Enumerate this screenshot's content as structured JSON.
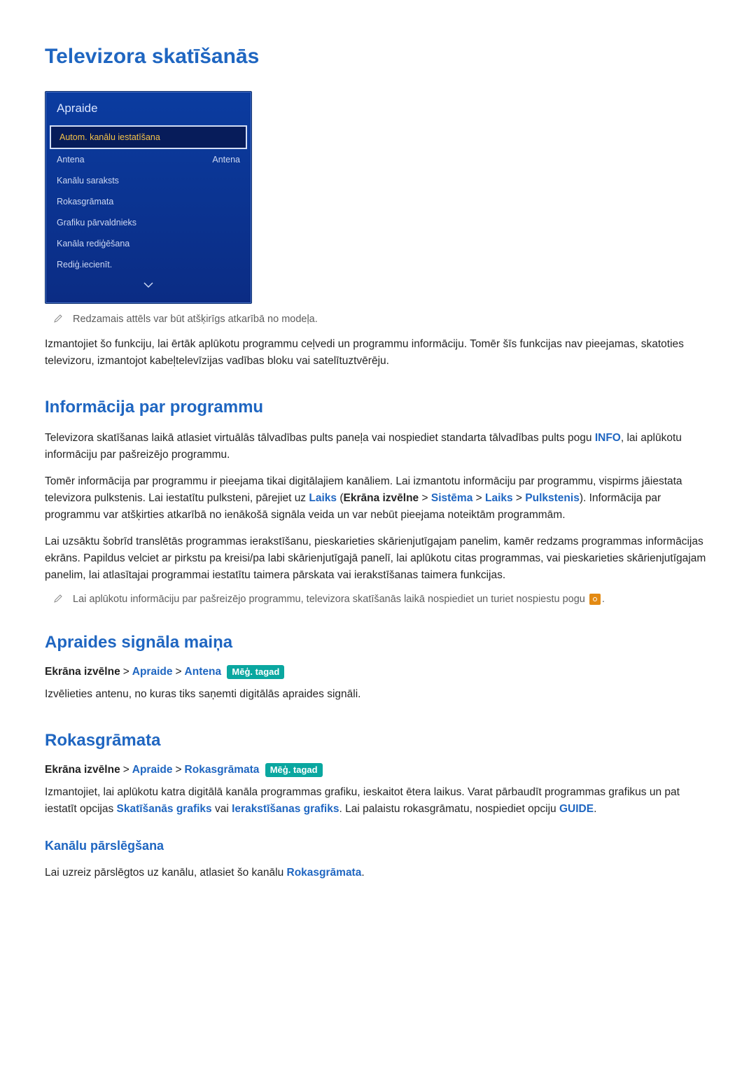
{
  "title": "Televizora skatīšanās",
  "tvmenu": {
    "header": "Apraide",
    "items": [
      {
        "label": "Autom. kanālu iestatīšana",
        "value": ""
      },
      {
        "label": "Antena",
        "value": "Antena"
      },
      {
        "label": "Kanālu saraksts",
        "value": ""
      },
      {
        "label": "Rokasgrāmata",
        "value": ""
      },
      {
        "label": "Grafiku pārvaldnieks",
        "value": ""
      },
      {
        "label": "Kanāla rediģēšana",
        "value": ""
      },
      {
        "label": "Rediģ.iecienīt.",
        "value": ""
      }
    ]
  },
  "note1": "Redzamais attēls var būt atšķirīgs atkarībā no modeļa.",
  "intro": "Izmantojiet šo funkciju, lai ērtāk aplūkotu programmu ceļvedi un programmu informāciju. Tomēr šīs funkcijas nav pieejamas, skatoties televizoru, izmantojot kabeļtelevīzijas vadības bloku vai satelītuztvērēju.",
  "s1": {
    "title": "Informācija par programmu",
    "p1_a": "Televizora skatīšanas laikā atlasiet virtuālās tālvadības pults paneļa vai nospiediet standarta tālvadības pults pogu ",
    "p1_info": "INFO",
    "p1_b": ", lai aplūkotu informāciju par pašreizējo programmu.",
    "p2_a": "Tomēr informācija par programmu ir pieejama tikai digitālajiem kanāliem. Lai izmantotu informāciju par programmu, vispirms jāiestata televizora pulkstenis. Lai iestatītu pulksteni, pārejiet uz ",
    "p2_laiks1": "Laiks",
    "p2_open": " (",
    "p2_ekr": "Ekrāna izvēlne",
    "p2_gt1": " > ",
    "p2_sistema": "Sistēma",
    "p2_gt2": " > ",
    "p2_laiks2": "Laiks",
    "p2_gt3": " > ",
    "p2_pulk": "Pulkstenis",
    "p2_close": "). Informācija par programmu var atšķirties atkarībā no ienākošā signāla veida un var nebūt pieejama noteiktām programmām.",
    "p3": "Lai uzsāktu šobrīd translētās programmas ierakstīšanu, pieskarieties skārienjutīgajam panelim, kamēr redzams programmas informācijas ekrāns. Papildus velciet ar pirkstu pa kreisi/pa labi skārienjutīgajā panelī, lai aplūkotu citas programmas, vai pieskarieties skārienjutīgajam panelim, lai atlasītajai programmai iestatītu taimera pārskata vai ierakstīšanas taimera funkcijas.",
    "note2a": "Lai aplūkotu informāciju par pašreizējo programmu, televizora skatīšanās laikā nospiediet un turiet nospiestu pogu ",
    "note2b": "."
  },
  "s2": {
    "title": "Apraides signāla maiņa",
    "path_ekr": "Ekrāna izvēlne",
    "path_apr": "Apraide",
    "path_ant": "Antena",
    "try": "Mēģ. tagad",
    "p1": "Izvēlieties antenu, no kuras tiks saņemti digitālās apraides signāli."
  },
  "s3": {
    "title": "Rokasgrāmata",
    "path_ekr": "Ekrāna izvēlne",
    "path_apr": "Apraide",
    "path_rok": "Rokasgrāmata",
    "try": "Mēģ. tagad",
    "p1_a": "Izmantojiet, lai aplūkotu katra digitālā kanāla programmas grafiku, ieskaitot ētera laikus. Varat pārbaudīt programmas grafikus un pat iestatīt opcijas ",
    "p1_sk": "Skatīšanās grafiks",
    "p1_or": " vai ",
    "p1_ier": "Ierakstīšanas grafiks",
    "p1_b": ". Lai palaistu rokasgrāmatu, nospiediet opciju ",
    "p1_guide": "GUIDE",
    "p1_c": ".",
    "sub_title": "Kanālu pārslēgšana",
    "sub_p_a": "Lai uzreiz pārslēgtos uz kanālu, atlasiet šo kanālu ",
    "sub_p_rok": "Rokasgrāmata",
    "sub_p_b": "."
  }
}
